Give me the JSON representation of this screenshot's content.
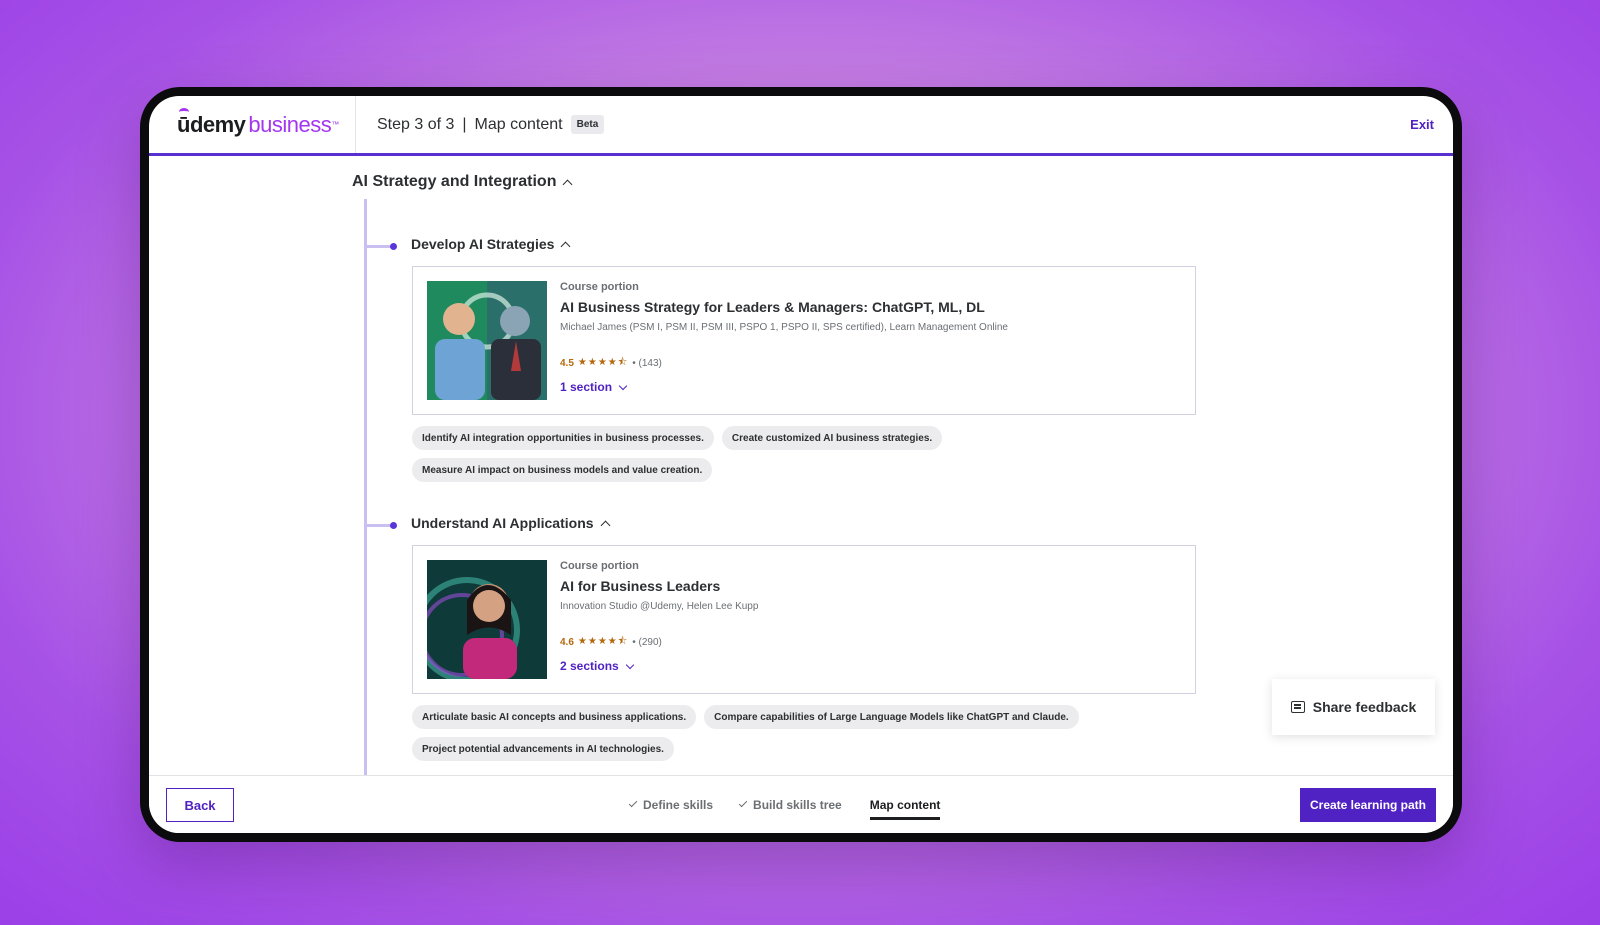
{
  "header": {
    "logo_udemy": "ūdemy",
    "logo_business": "business",
    "logo_tm": "™",
    "step_text": "Step 3 of 3",
    "separator": "|",
    "step_name": "Map content",
    "badge": "Beta",
    "exit_label": "Exit"
  },
  "main": {
    "section_title": "AI Strategy and Integration",
    "skills": [
      {
        "title": "Develop AI Strategies",
        "course": {
          "portion_label": "Course portion",
          "title": "AI Business Strategy for Leaders & Managers: ChatGPT, ML, DL",
          "instructors": "Michael James (PSM I, PSM II, PSM III, PSPO 1, PSPO II, SPS certified), Learn Management Online",
          "rating": "4.5",
          "stars": "★★★★⯪",
          "reviews": "• (143)",
          "sections": "1 section"
        },
        "tags": [
          "Identify AI integration opportunities in business processes.",
          "Create customized AI business strategies.",
          "Measure AI impact on business models and value creation."
        ]
      },
      {
        "title": "Understand AI Applications",
        "course": {
          "portion_label": "Course portion",
          "title": "AI for Business Leaders",
          "instructors": "Innovation Studio @Udemy, Helen Lee Kupp",
          "rating": "4.6",
          "stars": "★★★★⯪",
          "reviews": "• (290)",
          "sections": "2 sections"
        },
        "tags": [
          "Articulate basic AI concepts and business applications.",
          "Compare capabilities of Large Language Models like ChatGPT and Claude.",
          "Project potential advancements in AI technologies."
        ]
      }
    ],
    "feedback_label": "Share feedback"
  },
  "footer": {
    "back_label": "Back",
    "steps": [
      "Define skills",
      "Build skills tree",
      "Map content"
    ],
    "create_label": "Create learning path"
  },
  "colors": {
    "accent": "#5022c3",
    "brand": "#a435f0",
    "rating": "#b4690e"
  }
}
